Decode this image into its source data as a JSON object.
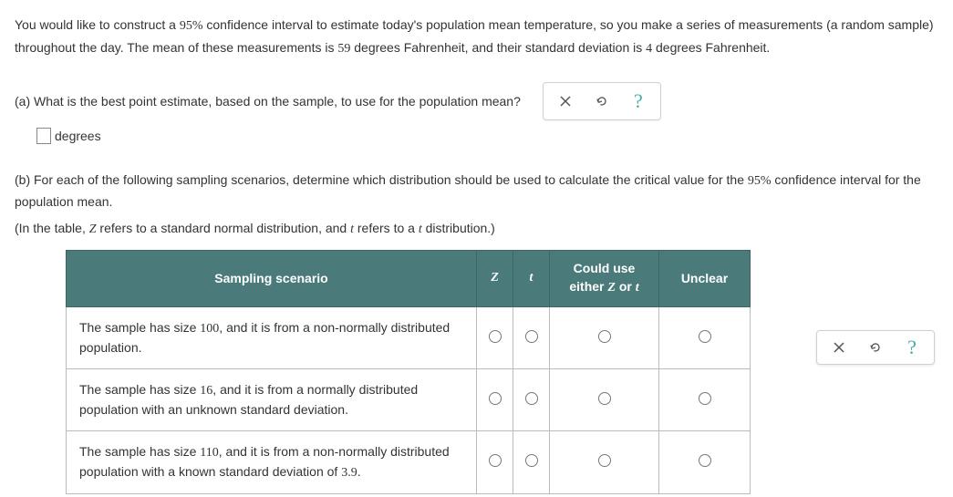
{
  "intro": {
    "part1": "You would like to construct a ",
    "pct": "95%",
    "part2": " confidence interval to estimate today's population mean temperature, so you make a series of measurements (a random sample) throughout the day. The mean of these measurements is ",
    "mean": "59",
    "part3": " degrees Fahrenheit, and their standard deviation is ",
    "sd": "4",
    "part4": " degrees Fahrenheit."
  },
  "qa": {
    "text": "(a) What is the best point estimate, based on the sample, to use for the population mean?",
    "unit": "degrees"
  },
  "toolbar": {
    "close": "×",
    "reset": "↺",
    "help": "?"
  },
  "qb": {
    "line1a": "(b) For each of the following sampling scenarios, determine which distribution should be used to calculate the critical value for the ",
    "line1pct": "95%",
    "line1b": " confidence interval for the population mean.",
    "note_a": "(In the table, ",
    "note_z": "Z",
    "note_b": " refers to a standard normal distribution, and ",
    "note_t": "t",
    "note_c": " refers to a ",
    "note_t2": "t",
    "note_d": " distribution.)"
  },
  "table": {
    "headers": {
      "scenario": "Sampling scenario",
      "z": "Z",
      "t": "t",
      "either_a": "Could use",
      "either_b": "either ",
      "either_z": "Z",
      "either_or": " or ",
      "either_t": "t",
      "unclear": "Unclear"
    },
    "rows": [
      {
        "a": "The sample has size ",
        "n": "100",
        "b": ", and it is from a non-normally distributed population."
      },
      {
        "a": "The sample has size ",
        "n": "16",
        "b": ", and it is from a normally distributed population with an unknown standard deviation."
      },
      {
        "a": "The sample has size ",
        "n": "110",
        "b": ", and it is from a non-normally distributed population with a known standard deviation of ",
        "sd": "3.9",
        "c": "."
      }
    ]
  }
}
